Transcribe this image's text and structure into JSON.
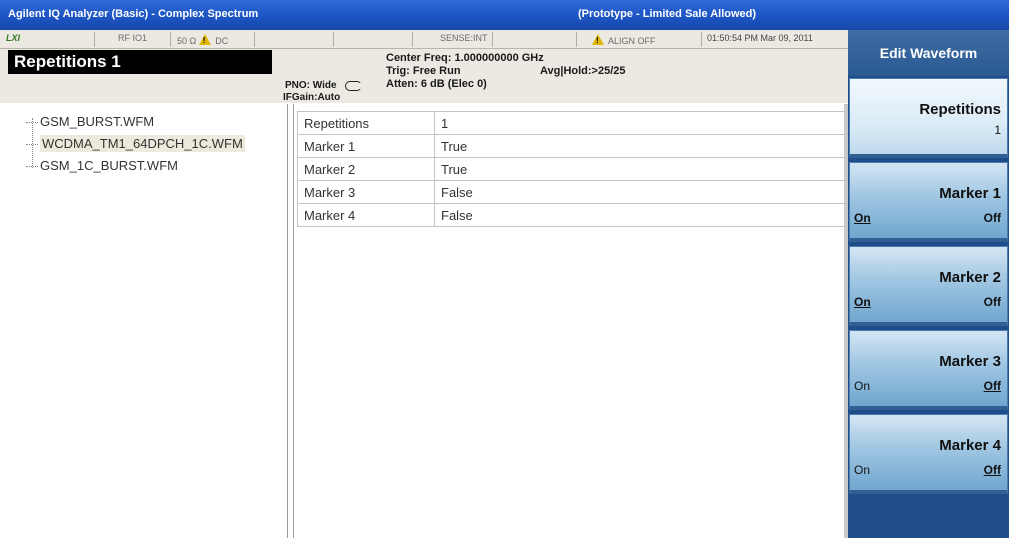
{
  "titlebar": {
    "app_title": "Agilent IQ Analyzer (Basic) - Complex Spectrum",
    "notice": "(Prototype - Limited Sale Allowed)"
  },
  "status": {
    "lxi": "LXI",
    "input": "RF IO1",
    "impedance": "50 Ω",
    "coupling": "DC",
    "sense": "SENSE:INT",
    "align": "ALIGN OFF",
    "datetime": "01:50:54 PM Mar 09, 2011"
  },
  "active_function": "Repetitions 1",
  "settings": {
    "center_freq": "Center Freq: 1.000000000 GHz",
    "trig": "Trig: Free Run",
    "atten": "Atten: 6 dB (Elec 0)",
    "avg_hold": "Avg|Hold:>25/25",
    "pno": "PNO: Wide",
    "ifgain": "IFGain:Auto"
  },
  "files": [
    {
      "name": "GSM_BURST.WFM",
      "selected": false
    },
    {
      "name": "WCDMA_TM1_64DPCH_1C.WFM",
      "selected": true
    },
    {
      "name": "GSM_1C_BURST.WFM",
      "selected": false
    }
  ],
  "table": {
    "rows": [
      {
        "name": "Repetitions",
        "value": "1"
      },
      {
        "name": "Marker 1",
        "value": "True"
      },
      {
        "name": "Marker 2",
        "value": "True"
      },
      {
        "name": "Marker 3",
        "value": "False"
      },
      {
        "name": "Marker 4",
        "value": "False"
      }
    ]
  },
  "softkeys": {
    "menu_title": "Edit Waveform",
    "keys": [
      {
        "label": "Repetitions",
        "value": "1"
      },
      {
        "label": "Marker 1",
        "on": "On",
        "off": "Off",
        "selected": "On"
      },
      {
        "label": "Marker 2",
        "on": "On",
        "off": "Off",
        "selected": "On"
      },
      {
        "label": "Marker 3",
        "on": "On",
        "off": "Off",
        "selected": "Off"
      },
      {
        "label": "Marker 4",
        "on": "On",
        "off": "Off",
        "selected": "Off"
      }
    ]
  },
  "colors": {
    "titlebar": "#1d55c4",
    "softkey_panel": "#1f4d8a",
    "active_function_bg": "#000000"
  }
}
